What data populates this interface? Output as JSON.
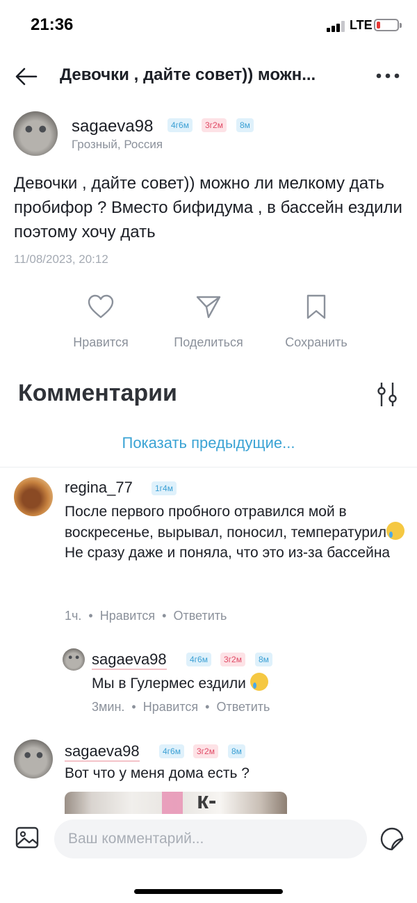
{
  "status_bar": {
    "time": "21:36",
    "network": "LTE"
  },
  "nav": {
    "title": "Девочки , дайте совет)) можн..."
  },
  "post": {
    "author": "sagaeva98",
    "badges": [
      "4г6м",
      "3г2м",
      "8м"
    ],
    "location": "Грозный, Россия",
    "text": "Девочки , дайте совет)) можно ли мелкому дать пробифор ? Вместо бифидума , в бассейн ездили поэтому хочу дать",
    "date": "11/08/2023, 20:12"
  },
  "actions": {
    "like": "Нравится",
    "share": "Поделиться",
    "save": "Сохранить"
  },
  "comments_section": {
    "title": "Комментарии",
    "show_previous": "Показать предыдущие..."
  },
  "comments": [
    {
      "author": "regina_77",
      "badges": [
        "1г4м"
      ],
      "line1": "После первого пробного отравился мой в воскресенье, вырывал, поносил, температурил",
      "line2": "Не сразу даже и поняла, что это из-за бассейна",
      "time": "1ч.",
      "like": "Нравится",
      "reply": "Ответить"
    },
    {
      "author": "sagaeva98",
      "badges": [
        "4г6м",
        "3г2м",
        "8м"
      ],
      "text": "Мы в Гулермес ездили",
      "time": "3мин.",
      "like": "Нравится",
      "reply": "Ответить"
    },
    {
      "author": "sagaeva98",
      "badges": [
        "4г6м",
        "3г2м",
        "8м"
      ],
      "text": "Вот что у меня дома есть ?"
    }
  ],
  "composer": {
    "placeholder": "Ваш комментарий..."
  },
  "colors": {
    "accent": "#3aa3d4",
    "badge_blue": "#3a9fd4",
    "badge_pink": "#e04a65",
    "muted": "#8b919b"
  }
}
